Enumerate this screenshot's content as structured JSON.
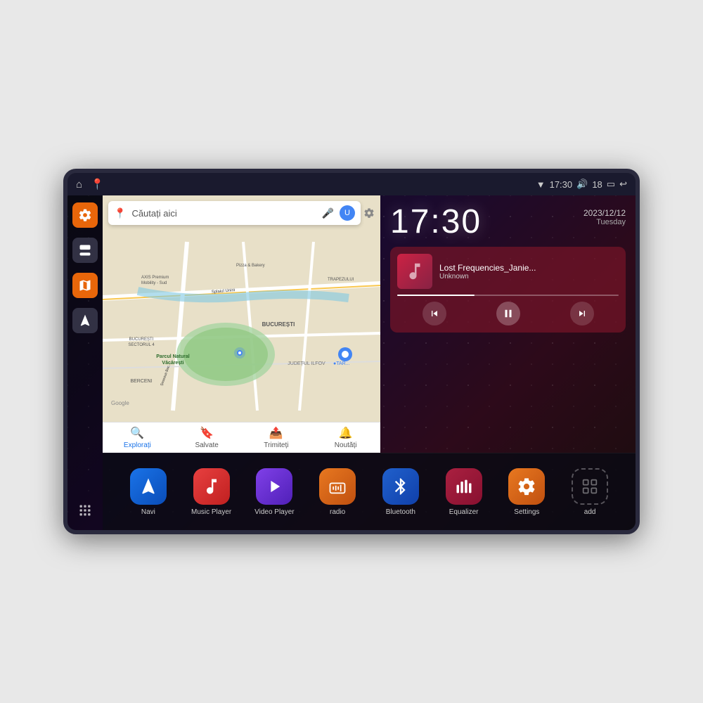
{
  "device": {
    "status_bar": {
      "left_icons": [
        "home",
        "map-pin"
      ],
      "time": "17:30",
      "signal_icon": "wifi",
      "volume_icon": "speaker",
      "battery_level": "18",
      "battery_icon": "battery",
      "back_icon": "back-arrow"
    },
    "clock": {
      "time": "17:30",
      "date": "2023/12/12",
      "day": "Tuesday"
    },
    "music": {
      "title": "Lost Frequencies_Janie...",
      "artist": "Unknown",
      "progress": 35
    },
    "map": {
      "search_placeholder": "Căutați aici",
      "labels": [
        "Parcul Natural Văcărești",
        "BUCUREȘTI",
        "JUDEȚUL ILFOV",
        "BERCENI",
        "BUCUREȘTI SECTORUL 4",
        "AXIS Premium Mobility - Sud",
        "Pizza & Bakery",
        "TRAPEZULUI"
      ],
      "bottom_nav": [
        {
          "label": "Explorați",
          "icon": "🔍"
        },
        {
          "label": "Salvate",
          "icon": "🔖"
        },
        {
          "label": "Trimiteți",
          "icon": "📤"
        },
        {
          "label": "Noutăți",
          "icon": "🔔"
        }
      ]
    },
    "sidebar": {
      "items": [
        {
          "label": "settings",
          "type": "orange"
        },
        {
          "label": "layers",
          "type": "dark"
        },
        {
          "label": "map",
          "type": "orange"
        },
        {
          "label": "navigate",
          "type": "dark"
        }
      ],
      "bottom": "grid"
    },
    "apps": [
      {
        "label": "Navi",
        "icon_type": "blue",
        "icon": "navigate"
      },
      {
        "label": "Music Player",
        "icon_type": "red",
        "icon": "music"
      },
      {
        "label": "Video Player",
        "icon_type": "purple",
        "icon": "play"
      },
      {
        "label": "radio",
        "icon_type": "orange",
        "icon": "radio"
      },
      {
        "label": "Bluetooth",
        "icon_type": "bt-blue",
        "icon": "bluetooth"
      },
      {
        "label": "Equalizer",
        "icon_type": "dark-red",
        "icon": "equalizer"
      },
      {
        "label": "Settings",
        "icon_type": "gear-orange",
        "icon": "settings"
      },
      {
        "label": "add",
        "icon_type": "add-gray",
        "icon": "+"
      }
    ]
  }
}
